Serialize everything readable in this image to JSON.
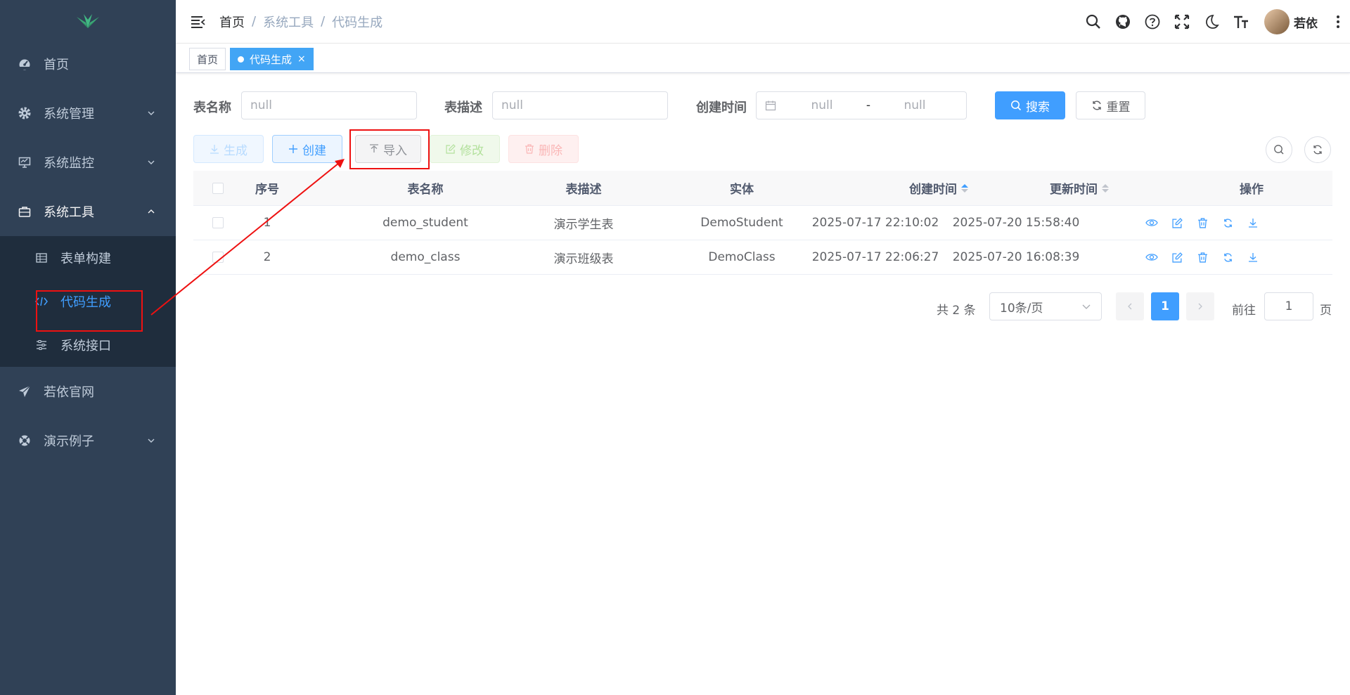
{
  "sidebar": {
    "menu": [
      {
        "label": "首页",
        "icon": "dashboard-icon"
      },
      {
        "label": "系统管理",
        "icon": "gear-icon"
      },
      {
        "label": "系统监控",
        "icon": "monitor-icon"
      },
      {
        "label": "系统工具",
        "icon": "toolbox-icon"
      }
    ],
    "submenu": [
      {
        "label": "表单构建",
        "icon": "table-icon"
      },
      {
        "label": "代码生成",
        "icon": "code-icon"
      },
      {
        "label": "系统接口",
        "icon": "sliders-icon"
      }
    ],
    "menu_after": [
      {
        "label": "若依官网",
        "icon": "paper-plane-icon"
      },
      {
        "label": "演示例子",
        "icon": "lifebuoy-icon"
      }
    ]
  },
  "header": {
    "breadcrumb": [
      "首页",
      "系统工具",
      "代码生成"
    ],
    "separator": "/",
    "user_name": "若依"
  },
  "tags": {
    "home": "首页",
    "active": "代码生成",
    "close": "×"
  },
  "search": {
    "table_name_label": "表名称",
    "table_name_placeholder": "null",
    "table_desc_label": "表描述",
    "table_desc_placeholder": "null",
    "create_time_label": "创建时间",
    "date_start_placeholder": "null",
    "date_sep": "-",
    "date_end_placeholder": "null",
    "search_btn": "搜索",
    "reset_btn": "重置"
  },
  "toolbar": {
    "generate": "生成",
    "create": "创建",
    "import": "导入",
    "edit": "修改",
    "delete": "删除"
  },
  "table": {
    "columns": [
      "序号",
      "表名称",
      "表描述",
      "实体",
      "创建时间",
      "更新时间",
      "操作"
    ],
    "rows": [
      {
        "index": "1",
        "table_name": "demo_student",
        "table_comment": "演示学生表",
        "class_name": "DemoStudent",
        "create_time": "2025-07-17 22:10:02",
        "update_time": "2025-07-20 15:58:40"
      },
      {
        "index": "2",
        "table_name": "demo_class",
        "table_comment": "演示班级表",
        "class_name": "DemoClass",
        "create_time": "2025-07-17 22:06:27",
        "update_time": "2025-07-20 16:08:39"
      }
    ]
  },
  "pagination": {
    "total_text": "共 2 条",
    "page_size": "10条/页",
    "current_page": "1",
    "goto_label": "前往",
    "goto_value": "1",
    "page_unit": "页"
  },
  "colors": {
    "sidebar_bg": "#304156",
    "primary": "#409eff",
    "annotation": "#ee1111"
  }
}
